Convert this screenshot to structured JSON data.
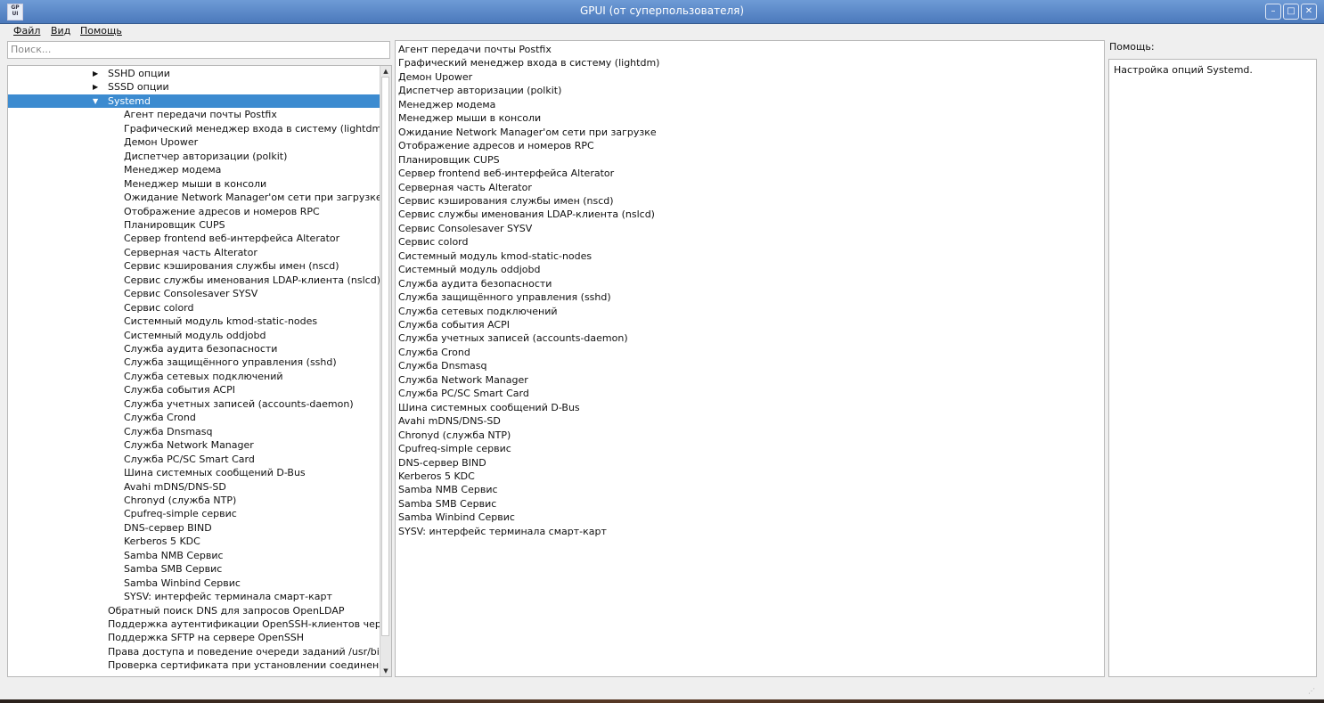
{
  "window": {
    "title": "GPUI (от суперпользователя)",
    "icon_text": "GP UI",
    "buttons": [
      "minimize",
      "maximize",
      "close"
    ]
  },
  "menu": {
    "items": [
      "Файл",
      "Вид",
      "Помощь"
    ]
  },
  "search": {
    "placeholder": "Поиск..."
  },
  "tree": {
    "rows": [
      {
        "label": "SSHD опции",
        "level": 1,
        "expander": "collapsed",
        "selected": false
      },
      {
        "label": "SSSD опции",
        "level": 1,
        "expander": "collapsed",
        "selected": false
      },
      {
        "label": "Systemd",
        "level": 1,
        "expander": "expanded",
        "selected": true
      },
      {
        "label": "Агент передачи почты Postfix",
        "level": 2
      },
      {
        "label": "Графический менеджер входа в систему (lightdm)",
        "level": 2
      },
      {
        "label": "Демон Upower",
        "level": 2
      },
      {
        "label": "Диспетчер авторизации (polkit)",
        "level": 2
      },
      {
        "label": "Менеджер модема",
        "level": 2
      },
      {
        "label": "Менеджер мыши в консоли",
        "level": 2
      },
      {
        "label": "Ожидание Network Manager'ом сети при загрузке",
        "level": 2
      },
      {
        "label": "Отображение адресов и номеров RPC",
        "level": 2
      },
      {
        "label": "Планировщик CUPS",
        "level": 2
      },
      {
        "label": "Сервер frontend веб-интерфейса Alterator",
        "level": 2
      },
      {
        "label": "Серверная часть Alterator",
        "level": 2
      },
      {
        "label": "Сервис кэширования службы имен (nscd)",
        "level": 2
      },
      {
        "label": "Сервис службы именования LDAP-клиента (nslcd)",
        "level": 2
      },
      {
        "label": "Сервис Consolesaver SYSV",
        "level": 2
      },
      {
        "label": "Сервис colord",
        "level": 2
      },
      {
        "label": "Системный модуль kmod-static-nodes",
        "level": 2
      },
      {
        "label": "Системный модуль oddjobd",
        "level": 2
      },
      {
        "label": "Служба аудита безопасности",
        "level": 2
      },
      {
        "label": "Служба защищённого управления (sshd)",
        "level": 2
      },
      {
        "label": "Служба сетевых подключений",
        "level": 2
      },
      {
        "label": "Служба события ACPI",
        "level": 2
      },
      {
        "label": "Служба учетных записей (accounts-daemon)",
        "level": 2
      },
      {
        "label": "Служба Crond",
        "level": 2
      },
      {
        "label": "Служба Dnsmasq",
        "level": 2
      },
      {
        "label": "Служба Network Manager",
        "level": 2
      },
      {
        "label": "Служба PC/SC Smart Card",
        "level": 2
      },
      {
        "label": "Шина системных сообщений D-Bus",
        "level": 2
      },
      {
        "label": "Avahi mDNS/DNS-SD",
        "level": 2
      },
      {
        "label": "Chronyd (служба NTP)",
        "level": 2
      },
      {
        "label": "Cpufreq-simple сервис",
        "level": 2
      },
      {
        "label": "DNS-сервер BIND",
        "level": 2
      },
      {
        "label": "Kerberos 5 KDC",
        "level": 2
      },
      {
        "label": "Samba NMB Сервис",
        "level": 2
      },
      {
        "label": "Samba SMB Сервис",
        "level": 2
      },
      {
        "label": "Samba Winbind Сервис",
        "level": 2
      },
      {
        "label": "SYSV: интерфейс терминала смарт-карт",
        "level": 2
      },
      {
        "label": "Обратный поиск DNS для запросов OpenLDAP",
        "level": 1
      },
      {
        "label": "Поддержка аутентификации OpenSSH-клиентов чере...",
        "level": 1
      },
      {
        "label": "Поддержка SFTP на сервере OpenSSH",
        "level": 1
      },
      {
        "label": "Права доступа и поведение очереди заданий /usr/bin/at",
        "level": 1
      },
      {
        "label": "Проверка сертификата при установлении соединени...",
        "level": 1
      }
    ]
  },
  "list": {
    "items": [
      "Агент передачи почты Postfix",
      "Графический менеджер входа в систему (lightdm)",
      "Демон Upower",
      "Диспетчер авторизации (polkit)",
      "Менеджер модема",
      "Менеджер мыши в консоли",
      "Ожидание Network Manager'ом сети при загрузке",
      "Отображение адресов и номеров RPC",
      "Планировщик CUPS",
      "Сервер frontend веб-интерфейса Alterator",
      "Серверная часть Alterator",
      "Сервис кэширования службы имен (nscd)",
      "Сервис службы именования LDAP-клиента (nslcd)",
      "Сервис Consolesaver SYSV",
      "Сервис colord",
      "Системный модуль kmod-static-nodes",
      "Системный модуль oddjobd",
      "Служба аудита безопасности",
      "Служба защищённого управления (sshd)",
      "Служба сетевых подключений",
      "Служба события ACPI",
      "Служба учетных записей (accounts-daemon)",
      "Служба Crond",
      "Служба Dnsmasq",
      "Служба Network Manager",
      "Служба PC/SC Smart Card",
      "Шина системных сообщений D-Bus",
      "Avahi mDNS/DNS-SD",
      "Chronyd (служба NTP)",
      "Cpufreq-simple сервис",
      "DNS-сервер BIND",
      "Kerberos 5 KDC",
      "Samba NMB Сервис",
      "Samba SMB Сервис",
      "Samba Winbind Сервис",
      "SYSV: интерфейс терминала смарт-карт"
    ]
  },
  "help": {
    "label": "Помощь:",
    "text": "Настройка опций Systemd."
  },
  "colors": {
    "selection": "#3c8bd0",
    "titlebar": "#5a87c7"
  }
}
